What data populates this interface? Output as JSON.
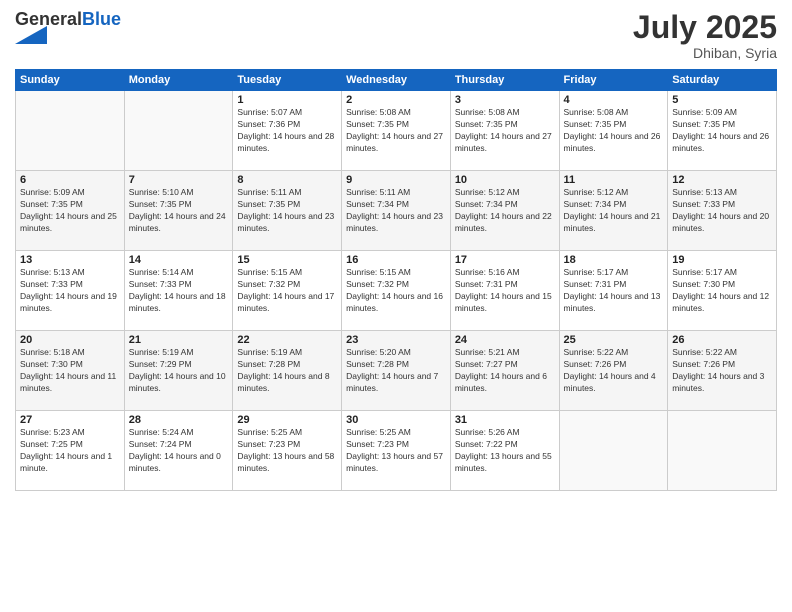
{
  "header": {
    "logo_general": "General",
    "logo_blue": "Blue",
    "month_year": "July 2025",
    "location": "Dhiban, Syria"
  },
  "weekdays": [
    "Sunday",
    "Monday",
    "Tuesday",
    "Wednesday",
    "Thursday",
    "Friday",
    "Saturday"
  ],
  "weeks": [
    [
      {
        "day": "",
        "info": ""
      },
      {
        "day": "",
        "info": ""
      },
      {
        "day": "1",
        "info": "Sunrise: 5:07 AM\nSunset: 7:36 PM\nDaylight: 14 hours and 28 minutes."
      },
      {
        "day": "2",
        "info": "Sunrise: 5:08 AM\nSunset: 7:35 PM\nDaylight: 14 hours and 27 minutes."
      },
      {
        "day": "3",
        "info": "Sunrise: 5:08 AM\nSunset: 7:35 PM\nDaylight: 14 hours and 27 minutes."
      },
      {
        "day": "4",
        "info": "Sunrise: 5:08 AM\nSunset: 7:35 PM\nDaylight: 14 hours and 26 minutes."
      },
      {
        "day": "5",
        "info": "Sunrise: 5:09 AM\nSunset: 7:35 PM\nDaylight: 14 hours and 26 minutes."
      }
    ],
    [
      {
        "day": "6",
        "info": "Sunrise: 5:09 AM\nSunset: 7:35 PM\nDaylight: 14 hours and 25 minutes."
      },
      {
        "day": "7",
        "info": "Sunrise: 5:10 AM\nSunset: 7:35 PM\nDaylight: 14 hours and 24 minutes."
      },
      {
        "day": "8",
        "info": "Sunrise: 5:11 AM\nSunset: 7:35 PM\nDaylight: 14 hours and 23 minutes."
      },
      {
        "day": "9",
        "info": "Sunrise: 5:11 AM\nSunset: 7:34 PM\nDaylight: 14 hours and 23 minutes."
      },
      {
        "day": "10",
        "info": "Sunrise: 5:12 AM\nSunset: 7:34 PM\nDaylight: 14 hours and 22 minutes."
      },
      {
        "day": "11",
        "info": "Sunrise: 5:12 AM\nSunset: 7:34 PM\nDaylight: 14 hours and 21 minutes."
      },
      {
        "day": "12",
        "info": "Sunrise: 5:13 AM\nSunset: 7:33 PM\nDaylight: 14 hours and 20 minutes."
      }
    ],
    [
      {
        "day": "13",
        "info": "Sunrise: 5:13 AM\nSunset: 7:33 PM\nDaylight: 14 hours and 19 minutes."
      },
      {
        "day": "14",
        "info": "Sunrise: 5:14 AM\nSunset: 7:33 PM\nDaylight: 14 hours and 18 minutes."
      },
      {
        "day": "15",
        "info": "Sunrise: 5:15 AM\nSunset: 7:32 PM\nDaylight: 14 hours and 17 minutes."
      },
      {
        "day": "16",
        "info": "Sunrise: 5:15 AM\nSunset: 7:32 PM\nDaylight: 14 hours and 16 minutes."
      },
      {
        "day": "17",
        "info": "Sunrise: 5:16 AM\nSunset: 7:31 PM\nDaylight: 14 hours and 15 minutes."
      },
      {
        "day": "18",
        "info": "Sunrise: 5:17 AM\nSunset: 7:31 PM\nDaylight: 14 hours and 13 minutes."
      },
      {
        "day": "19",
        "info": "Sunrise: 5:17 AM\nSunset: 7:30 PM\nDaylight: 14 hours and 12 minutes."
      }
    ],
    [
      {
        "day": "20",
        "info": "Sunrise: 5:18 AM\nSunset: 7:30 PM\nDaylight: 14 hours and 11 minutes."
      },
      {
        "day": "21",
        "info": "Sunrise: 5:19 AM\nSunset: 7:29 PM\nDaylight: 14 hours and 10 minutes."
      },
      {
        "day": "22",
        "info": "Sunrise: 5:19 AM\nSunset: 7:28 PM\nDaylight: 14 hours and 8 minutes."
      },
      {
        "day": "23",
        "info": "Sunrise: 5:20 AM\nSunset: 7:28 PM\nDaylight: 14 hours and 7 minutes."
      },
      {
        "day": "24",
        "info": "Sunrise: 5:21 AM\nSunset: 7:27 PM\nDaylight: 14 hours and 6 minutes."
      },
      {
        "day": "25",
        "info": "Sunrise: 5:22 AM\nSunset: 7:26 PM\nDaylight: 14 hours and 4 minutes."
      },
      {
        "day": "26",
        "info": "Sunrise: 5:22 AM\nSunset: 7:26 PM\nDaylight: 14 hours and 3 minutes."
      }
    ],
    [
      {
        "day": "27",
        "info": "Sunrise: 5:23 AM\nSunset: 7:25 PM\nDaylight: 14 hours and 1 minute."
      },
      {
        "day": "28",
        "info": "Sunrise: 5:24 AM\nSunset: 7:24 PM\nDaylight: 14 hours and 0 minutes."
      },
      {
        "day": "29",
        "info": "Sunrise: 5:25 AM\nSunset: 7:23 PM\nDaylight: 13 hours and 58 minutes."
      },
      {
        "day": "30",
        "info": "Sunrise: 5:25 AM\nSunset: 7:23 PM\nDaylight: 13 hours and 57 minutes."
      },
      {
        "day": "31",
        "info": "Sunrise: 5:26 AM\nSunset: 7:22 PM\nDaylight: 13 hours and 55 minutes."
      },
      {
        "day": "",
        "info": ""
      },
      {
        "day": "",
        "info": ""
      }
    ]
  ]
}
